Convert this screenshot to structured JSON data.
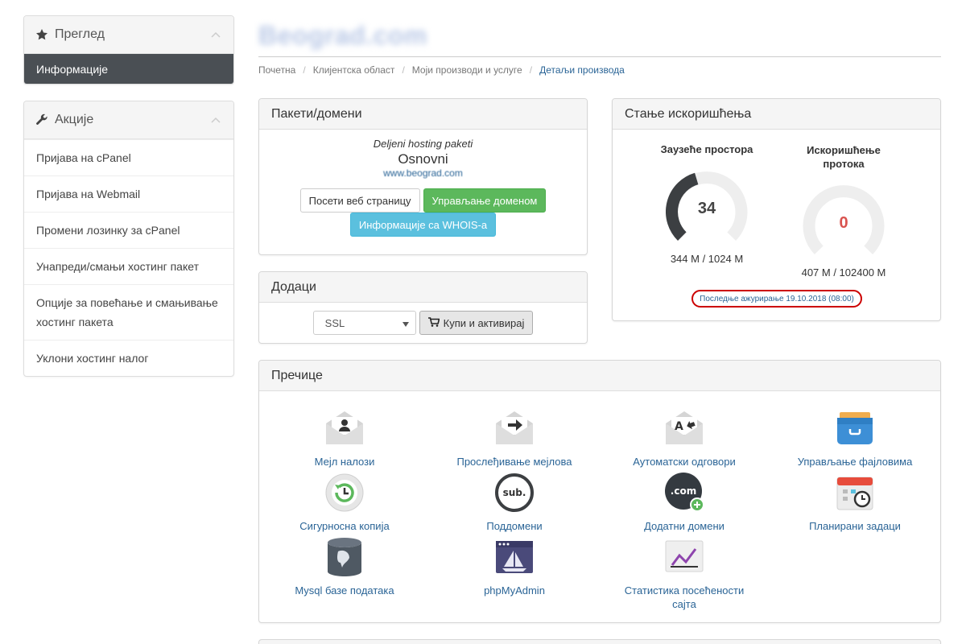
{
  "sidebar": {
    "overview": {
      "title": "Преглед",
      "active_item": "Информације"
    },
    "actions": {
      "title": "Акције",
      "items": [
        "Пријава на cPanel",
        "Пријава на Webmail",
        "Промени лозинку за cPanel",
        "Унапреди/смањи хостинг пакет",
        "Опције за повећање и смањивање хостинг пакета",
        "Уклони хостинг налог"
      ]
    }
  },
  "header": {
    "title": "Beograd.com",
    "breadcrumb": [
      "Почетна",
      "Клијентска област",
      "Моји производи и услуге",
      "Детаљи производа"
    ]
  },
  "packages": {
    "title": "Пакети/домени",
    "group": "Deljeni hosting paketi",
    "plan": "Osnovni",
    "domain": "www.beograd.com",
    "btn_visit": "Посети веб страницу",
    "btn_manage": "Управљање доменом",
    "btn_whois": "Информације са WHOIS-a"
  },
  "addons": {
    "title": "Додаци",
    "select_value": "SSL",
    "btn_buy": "Купи и активирај"
  },
  "usage": {
    "title": "Стање искоришћења",
    "disk": {
      "label": "Заузеће простора",
      "value": "34",
      "percent": 34,
      "detail": "344 M / 1024 M"
    },
    "bandwidth": {
      "label_line1": "Искоришћење",
      "label_line2": "протока",
      "value": "0",
      "percent": 0,
      "detail": "407 M / 102400 M"
    },
    "last_update": "Последње ажурирање 19.10.2018 (08:00)"
  },
  "shortcuts": {
    "title": "Пречице",
    "items": [
      {
        "label": "Мејл налози",
        "icon": "mail-accounts-icon"
      },
      {
        "label": "Прослеђивање мејлова",
        "icon": "mail-forward-icon"
      },
      {
        "label": "Аутоматски одговори",
        "icon": "autoresponder-icon"
      },
      {
        "label": "Управљање фајловима",
        "icon": "file-manager-icon"
      },
      {
        "label": "Сигурносна копија",
        "icon": "backup-icon"
      },
      {
        "label": "Поддомени",
        "icon": "subdomains-icon"
      },
      {
        "label": "Додатни домени",
        "icon": "addon-domains-icon"
      },
      {
        "label": "Планирани задаци",
        "icon": "cron-jobs-icon"
      },
      {
        "label": "Mysql базе података",
        "icon": "mysql-database-icon"
      },
      {
        "label": "phpMyAdmin",
        "icon": "phpmyadmin-icon"
      },
      {
        "label": "Статистика посећености сајта",
        "icon": "site-statistics-icon"
      }
    ]
  },
  "colors": {
    "active_bg": "#4a4f54",
    "green": "#5cb85c",
    "blue": "#5bc0de",
    "link": "#2a6496",
    "gauge_dark": "#3c3f42",
    "gauge_zero": "#d9534f",
    "highlight_ring": "#cc0000"
  }
}
